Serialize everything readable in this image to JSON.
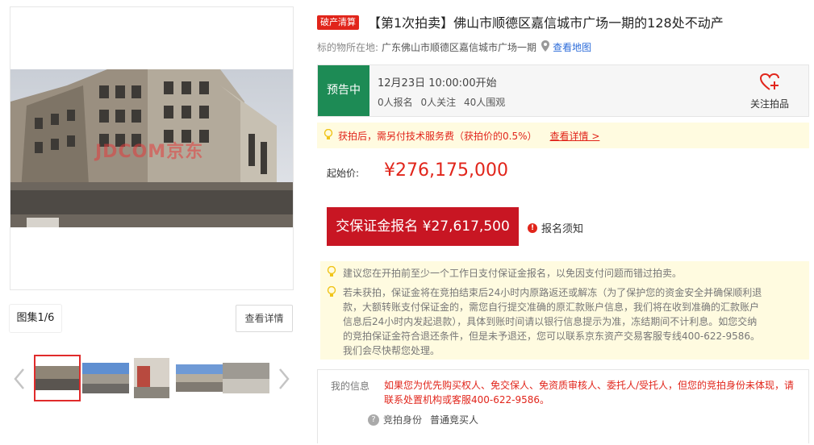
{
  "gallery": {
    "counter": "图集1/6",
    "view_detail": "查看详情",
    "watermark": "JDCOM京东",
    "thumb_count": 5
  },
  "auction": {
    "badge": "破产清算",
    "title": "【第1次拍卖】佛山市顺德区嘉信城市广场一期的128处不动产",
    "location_label": "标的物所在地:",
    "location": "广东佛山市顺德区嘉信城市广场一期",
    "map_link": "查看地图",
    "status": "预告中",
    "start_time": "12月23日 10:00:00开始",
    "stats": {
      "signups": "0人报名",
      "follows": "0人关注",
      "watchers": "40人围观"
    },
    "follow_label": "关注拍品",
    "fee_note": "获拍后，需另付技术服务费（获拍价的0.5%）",
    "fee_link": "查看详情 >",
    "price_label": "起始价:",
    "price": "¥276,175,000",
    "deposit_button": "交保证金报名 ¥27,617,500",
    "notice_link": "报名须知"
  },
  "tips": {
    "tip1": "建议您在开拍前至少一个工作日支付保证金报名，以免因支付问题而错过拍卖。",
    "tip2_lines": [
      "若未获拍，保证金将在竞拍结束后24小时内原路返还或解冻（为了保护您的资金安全并确保顺利退",
      "款，大额转账支付保证金的，需您自行提交准确的原汇款账户信息，我们将在收到准确的汇款账户",
      "信息后24小时内发起退款），具体到账时间请以银行信息提示为准，冻结期间不计利息。如您交纳",
      "的竞拍保证金符合退还条件，但是未予退还，您可以联系京东资产交易客服专线400-622-9586。",
      "我们会尽快帮您处理。"
    ]
  },
  "my_info": {
    "label": "我的信息",
    "message_lines": [
      "如果您为优先购买权人、免交保人、免资质审核人、委托人/受托人，但您的竞拍身份未体现，请",
      "联系处置机构或客服400-622-9586。"
    ],
    "identity_label": "竞拍身份",
    "identity_value": "普通竞买人"
  },
  "colors": {
    "accent": "#e1251b",
    "status_green": "#1d8b55",
    "tip_bg": "#fffbe0"
  }
}
